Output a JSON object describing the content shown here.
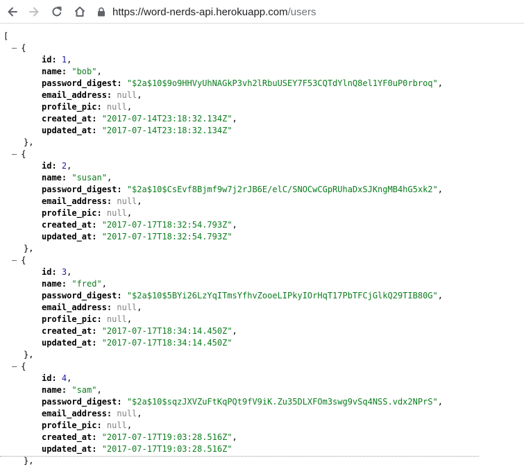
{
  "browser": {
    "url_domain": "https://word-nerds-api.herokuapp.com",
    "url_path": "/users"
  },
  "json_view": {
    "open_bracket": "[",
    "toggle": "–",
    "obj_open": "{",
    "obj_close": "},",
    "users": [
      {
        "id": "1",
        "name": "\"bob\"",
        "password_digest": "\"$2a$10$9o9HHVyUhNAGkP3vh2lRbuUSEY7F53CQTdYlnQ8el1YF0uP0rbroq\"",
        "email_address": "null",
        "profile_pic": "null",
        "created_at": "\"2017-07-14T23:18:32.134Z\"",
        "updated_at": "\"2017-07-14T23:18:32.134Z\""
      },
      {
        "id": "2",
        "name": "\"susan\"",
        "password_digest": "\"$2a$10$CsEvf8Bjmf9w7j2rJB6E/elC/SNOCwCGpRUhaDxSJKngMB4hG5xk2\"",
        "email_address": "null",
        "profile_pic": "null",
        "created_at": "\"2017-07-17T18:32:54.793Z\"",
        "updated_at": "\"2017-07-17T18:32:54.793Z\""
      },
      {
        "id": "3",
        "name": "\"fred\"",
        "password_digest": "\"$2a$10$5BYi26LzYqITmsYfhvZooeLIPkyIOrHqT17PbTFCjGlkQ29TIB80G\"",
        "email_address": "null",
        "profile_pic": "null",
        "created_at": "\"2017-07-17T18:34:14.450Z\"",
        "updated_at": "\"2017-07-17T18:34:14.450Z\""
      },
      {
        "id": "4",
        "name": "\"sam\"",
        "password_digest": "\"$2a$10$sqzJXVZuFtKqPQt9fV9iK.Zu35DLXFOm3swg9vSq4NSS.vdx2NPrS\"",
        "email_address": "null",
        "profile_pic": "null",
        "created_at": "\"2017-07-17T19:03:28.516Z\"",
        "updated_at": "\"2017-07-17T19:03:28.516Z\""
      }
    ]
  }
}
